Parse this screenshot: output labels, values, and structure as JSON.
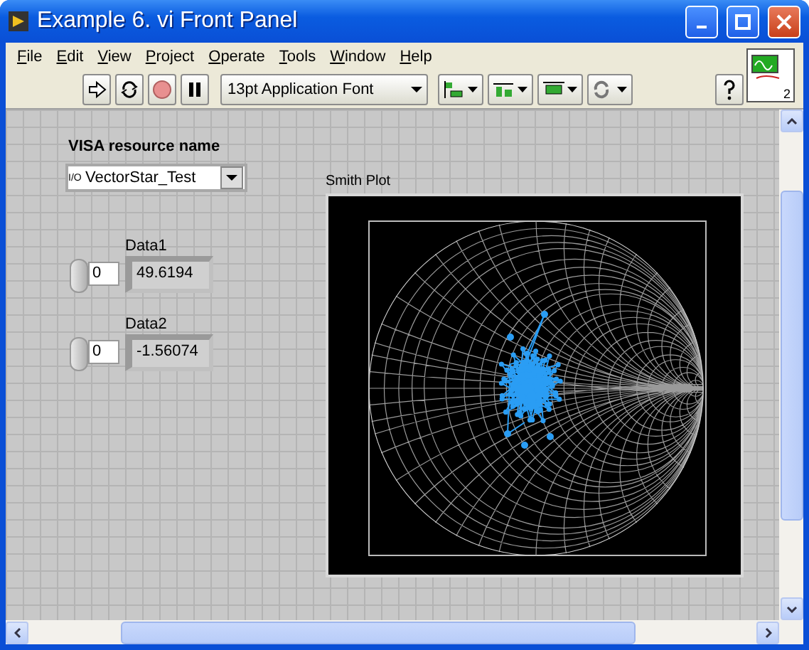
{
  "window": {
    "title": "Example 6. vi Front Panel"
  },
  "menu": [
    "File",
    "Edit",
    "View",
    "Project",
    "Operate",
    "Tools",
    "Window",
    "Help"
  ],
  "toolbar": {
    "font": "13pt Application Font"
  },
  "vi_icon": {
    "terminal_count": "2"
  },
  "visa": {
    "label": "VISA resource name",
    "prefix": "I/O",
    "value": "VectorStar_Test"
  },
  "numerics": [
    {
      "label": "Data1",
      "index": "0",
      "value": "49.6194"
    },
    {
      "label": "Data2",
      "index": "0",
      "value": "-1.56074"
    }
  ],
  "smith_plot": {
    "title": "Smith Plot"
  }
}
